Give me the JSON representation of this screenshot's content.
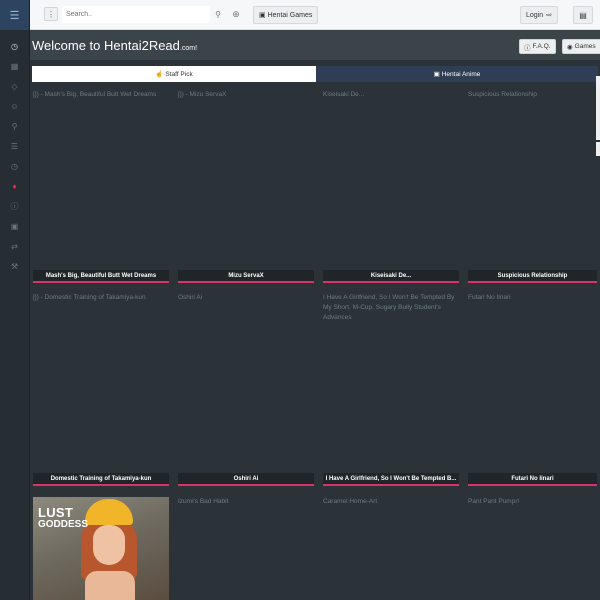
{
  "topbar": {
    "search_placeholder": "Search..",
    "hentai_games_label": "Hentai Games",
    "login_label": "Login"
  },
  "header": {
    "title": "Welcome to Hentai2Read",
    "domain": ".com!",
    "faq_label": "F.A.Q.",
    "games_label": "Games"
  },
  "tabs": {
    "staff_pick": "Staff Pick",
    "hentai_anime": "Hentai Anime"
  },
  "cards_row1": [
    {
      "alt": "[]) - Mash's Big, Beautiful Butt Wet Dreams",
      "caption": "Mash's Big, Beautiful Butt Wet Dreams"
    },
    {
      "alt": "[]) - Mizu ServaX",
      "caption": "Mizu ServaX"
    },
    {
      "alt": "Kiseisaki De...",
      "caption": "Kiseisaki De..."
    },
    {
      "alt": "Suspicious Relationship",
      "caption": "Suspicious Relationship"
    }
  ],
  "cards_row2": [
    {
      "alt": "[]) - Domestic Training of Takamiya-kun",
      "caption": "Domestic Training of Takamiya-kun"
    },
    {
      "alt": "Oshiri Ai",
      "caption": "Oshiri Ai"
    },
    {
      "alt": "I Have A Girlfriend, So I Won't Be Tempted By My Short, M-Cup, Sugary Bully Student's Advances",
      "caption": "I Have A Girlfriend, So I Won't Be Tempted B..."
    },
    {
      "alt": "Futari No Iinari",
      "caption": "Futari No Iinari"
    }
  ],
  "row3": {
    "ad_line1": "LUST",
    "ad_line2": "GODDESS",
    "alts": [
      "Izumi's Bad Habit",
      "Caramel Home-Art",
      "Pant Pant Pumpr!"
    ]
  },
  "accent_color": "#d8326a"
}
